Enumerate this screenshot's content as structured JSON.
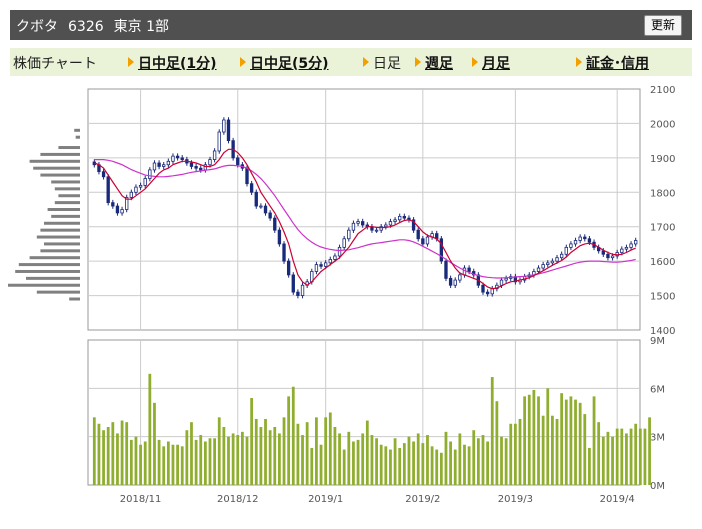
{
  "header": {
    "name": "クボタ",
    "code": "6326",
    "market": "東京 1部",
    "refresh_label": "更新"
  },
  "tabs": [
    {
      "label": "株価チャート",
      "link": false,
      "arrow": false
    },
    {
      "label": "日中足(1分)",
      "link": true,
      "arrow": true
    },
    {
      "label": "日中足(5分)",
      "link": true,
      "arrow": true
    },
    {
      "label": "日足",
      "link": false,
      "arrow": true
    },
    {
      "label": "週足",
      "link": true,
      "arrow": true
    },
    {
      "label": "月足",
      "link": true,
      "arrow": true
    },
    {
      "label": "証金･信用",
      "link": true,
      "arrow": true
    }
  ],
  "chart_data": {
    "type": "candlestick",
    "colors": {
      "up": "#ffffff",
      "down": "#1a2a7a",
      "outline": "#1a2a7a",
      "ma_short": "#cc0033",
      "ma_long": "#cc33cc",
      "volume": "#8fad2e",
      "volume_profile": "#808080",
      "grid": "#cccccc"
    },
    "price_axis": {
      "ylim": [
        1400,
        2100
      ],
      "ticks": [
        "2100",
        "2000",
        "1900",
        "1800",
        "1700",
        "1600",
        "1500",
        "1400"
      ]
    },
    "volume_axis": {
      "ylim": [
        0,
        9
      ],
      "unit": "M",
      "ticks": [
        "9M",
        "6M",
        "3M",
        "0M"
      ]
    },
    "x_labels": [
      {
        "label": "2018/11",
        "index": 10
      },
      {
        "label": "2018/12",
        "index": 31
      },
      {
        "label": "2019/1",
        "index": 50
      },
      {
        "label": "2019/2",
        "index": 71
      },
      {
        "label": "2019/3",
        "index": 91
      },
      {
        "label": "2019/4",
        "index": 113
      }
    ],
    "close": [
      1880,
      1860,
      1845,
      1770,
      1760,
      1740,
      1750,
      1785,
      1800,
      1815,
      1820,
      1840,
      1865,
      1885,
      1875,
      1880,
      1890,
      1905,
      1900,
      1895,
      1885,
      1875,
      1870,
      1865,
      1880,
      1895,
      1920,
      1975,
      2010,
      1950,
      1900,
      1880,
      1870,
      1825,
      1800,
      1760,
      1760,
      1740,
      1725,
      1690,
      1650,
      1600,
      1560,
      1510,
      1500,
      1530,
      1540,
      1570,
      1590,
      1585,
      1595,
      1605,
      1615,
      1640,
      1665,
      1690,
      1710,
      1715,
      1705,
      1700,
      1690,
      1690,
      1700,
      1705,
      1715,
      1720,
      1730,
      1725,
      1720,
      1690,
      1665,
      1650,
      1670,
      1680,
      1665,
      1600,
      1550,
      1530,
      1545,
      1560,
      1580,
      1570,
      1560,
      1530,
      1510,
      1505,
      1520,
      1530,
      1545,
      1550,
      1555,
      1540,
      1545,
      1555,
      1560,
      1570,
      1580,
      1590,
      1595,
      1600,
      1610,
      1620,
      1640,
      1650,
      1660,
      1670,
      1665,
      1655,
      1640,
      1630,
      1620,
      1610,
      1615,
      1625,
      1635,
      1640,
      1650,
      1660
    ],
    "ma_short": [
      1885,
      1880,
      1870,
      1850,
      1830,
      1810,
      1790,
      1780,
      1780,
      1790,
      1800,
      1810,
      1825,
      1840,
      1855,
      1865,
      1870,
      1880,
      1885,
      1890,
      1890,
      1888,
      1885,
      1880,
      1875,
      1875,
      1880,
      1895,
      1915,
      1925,
      1925,
      1915,
      1900,
      1880,
      1855,
      1830,
      1800,
      1780,
      1760,
      1740,
      1715,
      1685,
      1650,
      1600,
      1560,
      1540,
      1530,
      1540,
      1555,
      1570,
      1580,
      1590,
      1600,
      1610,
      1625,
      1640,
      1660,
      1680,
      1690,
      1700,
      1700,
      1698,
      1697,
      1698,
      1700,
      1705,
      1712,
      1718,
      1720,
      1715,
      1700,
      1685,
      1675,
      1670,
      1665,
      1650,
      1625,
      1600,
      1580,
      1565,
      1560,
      1555,
      1550,
      1545,
      1535,
      1525,
      1520,
      1522,
      1528,
      1535,
      1540,
      1542,
      1545,
      1548,
      1552,
      1558,
      1565,
      1572,
      1580,
      1588,
      1595,
      1602,
      1612,
      1625,
      1635,
      1645,
      1650,
      1652,
      1648,
      1640,
      1632,
      1625,
      1620,
      1618,
      1620,
      1625,
      1632,
      1638
    ],
    "ma_long": [
      1895,
      1895,
      1895,
      1893,
      1890,
      1885,
      1880,
      1873,
      1866,
      1860,
      1855,
      1850,
      1848,
      1846,
      1845,
      1845,
      1846,
      1848,
      1850,
      1852,
      1855,
      1858,
      1860,
      1862,
      1864,
      1866,
      1868,
      1872,
      1876,
      1878,
      1878,
      1877,
      1875,
      1870,
      1862,
      1852,
      1840,
      1825,
      1808,
      1790,
      1770,
      1750,
      1730,
      1710,
      1692,
      1677,
      1665,
      1655,
      1647,
      1641,
      1637,
      1634,
      1632,
      1631,
      1632,
      1633,
      1636,
      1639,
      1643,
      1647,
      1650,
      1652,
      1654,
      1656,
      1658,
      1660,
      1662,
      1662,
      1660,
      1656,
      1650,
      1643,
      1636,
      1629,
      1622,
      1614,
      1605,
      1596,
      1588,
      1580,
      1573,
      1567,
      1562,
      1558,
      1555,
      1553,
      1552,
      1551,
      1551,
      1552,
      1553,
      1554,
      1555,
      1556,
      1558,
      1560,
      1563,
      1566,
      1570,
      1574,
      1578,
      1582,
      1586,
      1590,
      1594,
      1597,
      1599,
      1600,
      1600,
      1600,
      1599,
      1598,
      1597,
      1597,
      1598,
      1600,
      1602,
      1605
    ],
    "volume": [
      4.2,
      3.8,
      3.4,
      3.6,
      3.9,
      3.2,
      4.0,
      3.9,
      2.8,
      3.0,
      2.5,
      2.7,
      6.9,
      5.1,
      2.8,
      2.4,
      2.7,
      2.5,
      2.5,
      2.4,
      3.4,
      3.9,
      2.8,
      3.1,
      2.7,
      2.9,
      2.9,
      4.2,
      3.6,
      3.0,
      3.2,
      3.1,
      3.3,
      3.0,
      5.4,
      4.1,
      3.6,
      4.1,
      3.4,
      3.6,
      3.2,
      4.2,
      5.5,
      6.1,
      3.8,
      3.1,
      3.9,
      2.3,
      4.2,
      2.5,
      4.2,
      4.5,
      3.6,
      3.2,
      2.2,
      3.3,
      2.7,
      2.8,
      3.2,
      4.0,
      3.1,
      2.9,
      2.5,
      2.4,
      2.2,
      2.9,
      2.3,
      2.6,
      3.0,
      2.7,
      3.2,
      2.6,
      3.1,
      2.4,
      2.2,
      2.0,
      3.3,
      2.7,
      2.2,
      3.2,
      2.5,
      2.4,
      3.4,
      2.9,
      3.1,
      2.7,
      6.7,
      5.2,
      3.0,
      2.9,
      3.8,
      3.8,
      4.1,
      5.5,
      5.6,
      5.9,
      5.5,
      4.3,
      6.0,
      4.3,
      4.1,
      5.7,
      5.3,
      5.5,
      5.3,
      5.1,
      4.4,
      2.3,
      5.5,
      3.9,
      3.0,
      3.3,
      3.0,
      3.5,
      3.5,
      3.2,
      3.5,
      3.8,
      3.5,
      3.5,
      4.2
    ],
    "volume_profile": [
      {
        "price": 1980,
        "weight": 0.08
      },
      {
        "price": 1960,
        "weight": 0.06
      },
      {
        "price": 1930,
        "weight": 0.3
      },
      {
        "price": 1910,
        "weight": 0.55
      },
      {
        "price": 1890,
        "weight": 0.7
      },
      {
        "price": 1870,
        "weight": 0.65
      },
      {
        "price": 1850,
        "weight": 0.55
      },
      {
        "price": 1830,
        "weight": 0.4
      },
      {
        "price": 1810,
        "weight": 0.35
      },
      {
        "price": 1790,
        "weight": 0.3
      },
      {
        "price": 1770,
        "weight": 0.35
      },
      {
        "price": 1750,
        "weight": 0.45
      },
      {
        "price": 1730,
        "weight": 0.4
      },
      {
        "price": 1710,
        "weight": 0.5
      },
      {
        "price": 1690,
        "weight": 0.55
      },
      {
        "price": 1670,
        "weight": 0.6
      },
      {
        "price": 1650,
        "weight": 0.5
      },
      {
        "price": 1630,
        "weight": 0.55
      },
      {
        "price": 1610,
        "weight": 0.7
      },
      {
        "price": 1590,
        "weight": 0.85
      },
      {
        "price": 1570,
        "weight": 0.9
      },
      {
        "price": 1550,
        "weight": 0.75
      },
      {
        "price": 1530,
        "weight": 1.0
      },
      {
        "price": 1510,
        "weight": 0.6
      },
      {
        "price": 1490,
        "weight": 0.15
      }
    ]
  }
}
